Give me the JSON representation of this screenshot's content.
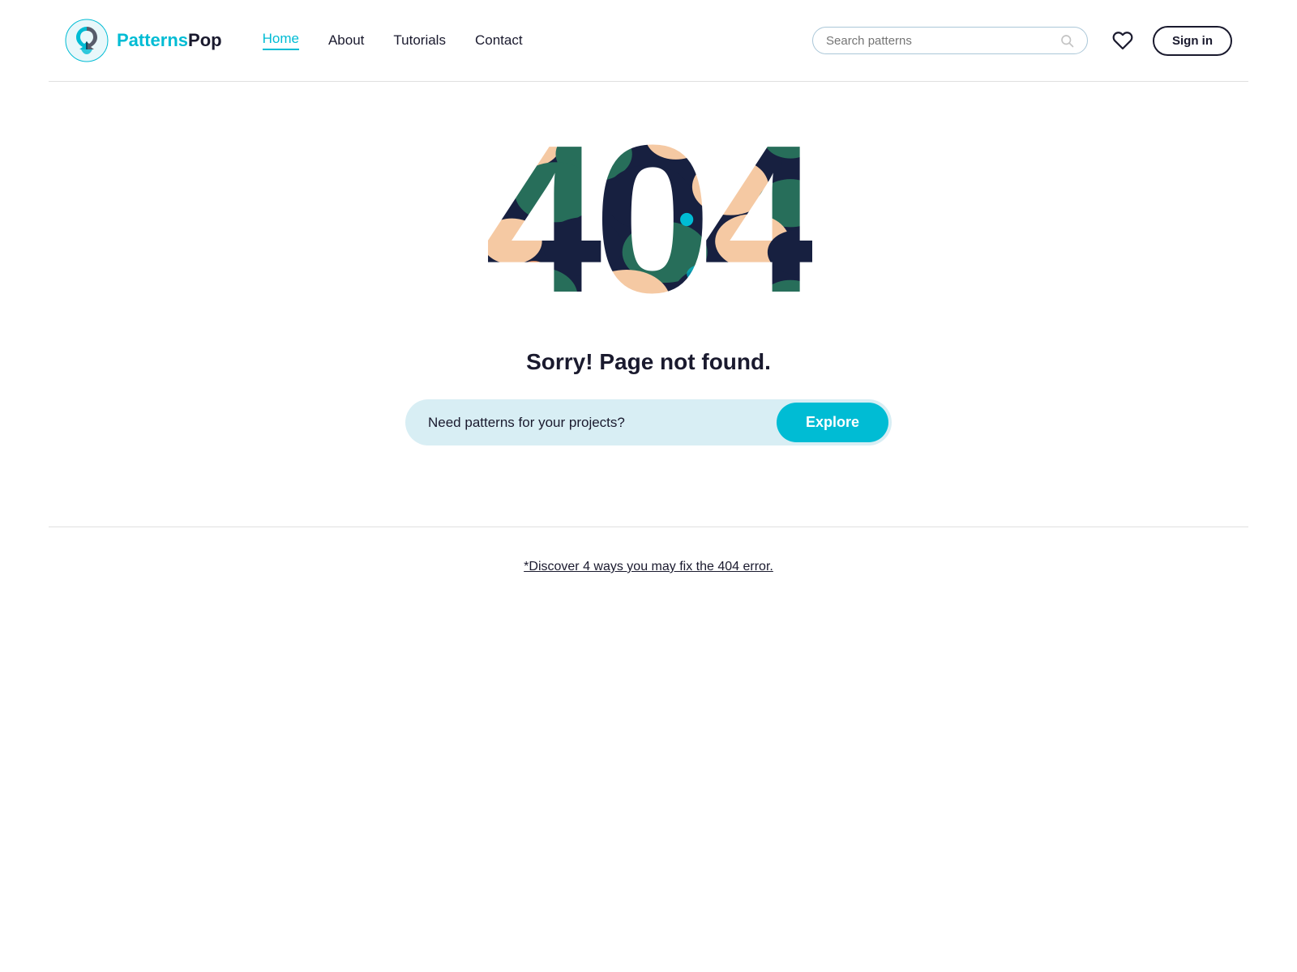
{
  "brand": {
    "name_part1": "Patterns",
    "name_part2": "Pop"
  },
  "nav": {
    "home": "Home",
    "about": "About",
    "tutorials": "Tutorials",
    "contact": "Contact"
  },
  "search": {
    "placeholder": "Search patterns"
  },
  "header_actions": {
    "signin": "Sign in"
  },
  "error_page": {
    "code": "404",
    "sorry_text": "Sorry! Page not found.",
    "cta_text": "Need patterns for your projects?",
    "explore_btn": "Explore",
    "footer_link": "*Discover 4 ways you may fix the 404 error."
  }
}
